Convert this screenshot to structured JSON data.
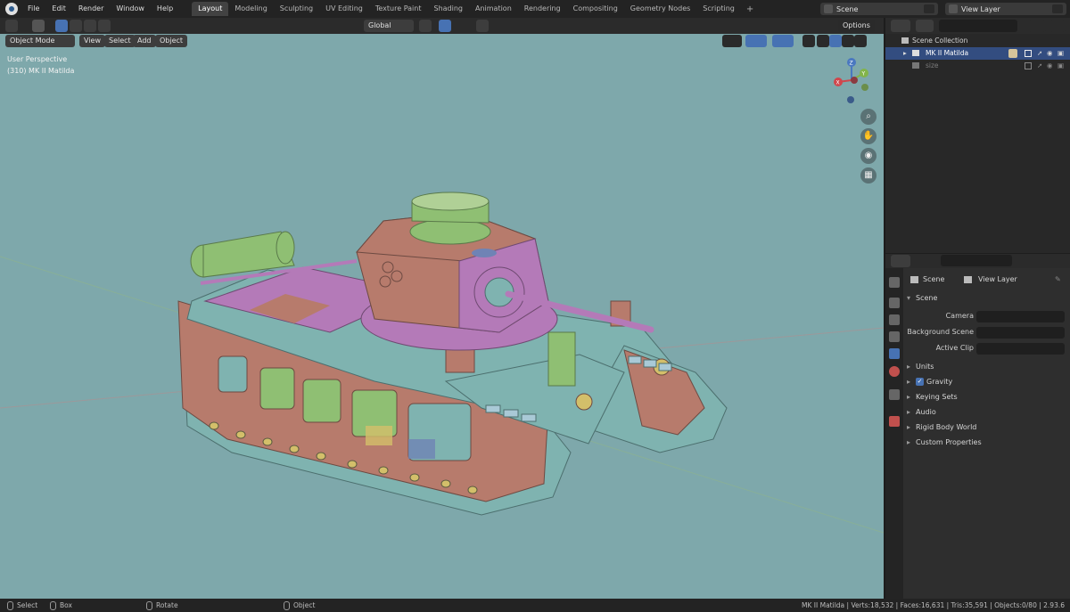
{
  "menu": [
    "File",
    "Edit",
    "Render",
    "Window",
    "Help"
  ],
  "workspaces": [
    {
      "label": "Layout",
      "active": true
    },
    {
      "label": "Modeling",
      "active": false
    },
    {
      "label": "Sculpting",
      "active": false
    },
    {
      "label": "UV Editing",
      "active": false
    },
    {
      "label": "Texture Paint",
      "active": false
    },
    {
      "label": "Shading",
      "active": false
    },
    {
      "label": "Animation",
      "active": false
    },
    {
      "label": "Rendering",
      "active": false
    },
    {
      "label": "Compositing",
      "active": false
    },
    {
      "label": "Geometry Nodes",
      "active": false
    },
    {
      "label": "Scripting",
      "active": false
    }
  ],
  "scene_field": "Scene",
  "view_layer_field": "View Layer",
  "viewport_header": {
    "mode": "Object Mode",
    "view": "View",
    "select": "Select",
    "add": "Add",
    "object": "Object",
    "transform_orientation": "Global",
    "options": "Options"
  },
  "viewport_overlay": {
    "perspective": "User Perspective",
    "object_info": "(310) MK II Matilda"
  },
  "gizmo": {
    "z": "Z",
    "y": "Y",
    "x": "X"
  },
  "outliner": {
    "root": "Scene Collection",
    "items": [
      {
        "label": "MK II Matilda",
        "selected": true
      },
      {
        "label": "size",
        "selected": false
      }
    ]
  },
  "properties": {
    "breadcrumb_scene": "Scene",
    "breadcrumb_layer": "View Layer",
    "panel_title": "Scene",
    "camera_label": "Camera",
    "background_label": "Background Scene",
    "clip_label": "Active Clip",
    "sections": [
      "Units",
      "Gravity",
      "Keying Sets",
      "Audio",
      "Rigid Body World",
      "Custom Properties"
    ],
    "gravity_enabled": true
  },
  "statusbar": {
    "select": "Select",
    "box_select": "Box Select",
    "rotate": "Rotate View",
    "context": "Object Context Menu",
    "stats": "MK II Matilda | Verts:18,532 | Faces:16,631 | Tris:35,591 | Objects:0/80 | 2.93.6"
  },
  "colors": {
    "viewport_bg": "#7ea8ab",
    "hull": "#7fb3b0",
    "armor": "#b77b6c",
    "turret_purple": "#b47ab8",
    "green": "#8fbf73",
    "accent": "#4772b3"
  }
}
